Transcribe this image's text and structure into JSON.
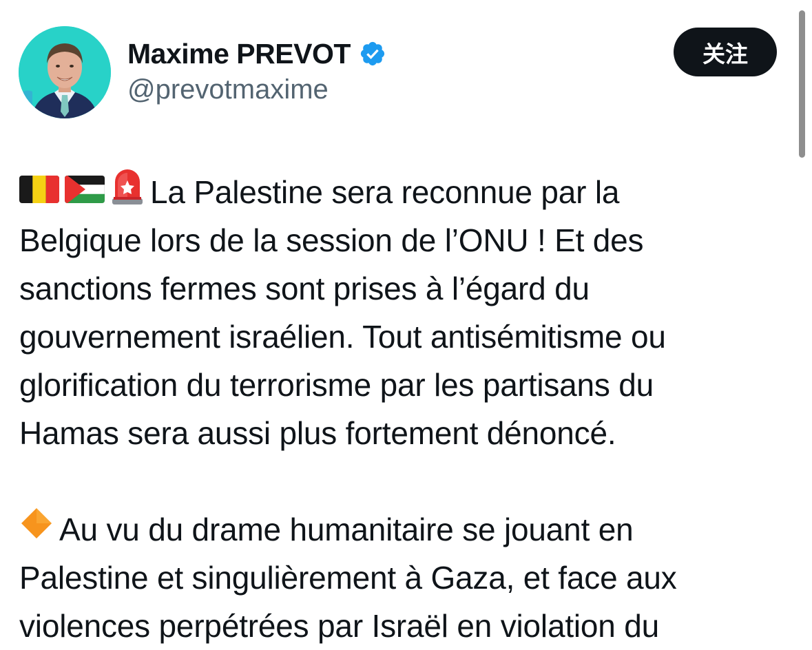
{
  "author": {
    "display_name": "Maxime PREVOT",
    "handle": "@prevotmaxime",
    "verified": true,
    "avatar_icon": "profile-photo"
  },
  "follow_button": {
    "label": "关注"
  },
  "colors": {
    "verified_blue": "#1d9bf0",
    "text_primary": "#0f1419",
    "text_secondary": "#536471",
    "avatar_bg": "#28d2c8"
  },
  "tweet": {
    "paragraph1": {
      "emojis": [
        "belgium-flag-icon",
        "palestine-flag-icon",
        "police-light-icon"
      ],
      "lines": [
        "La Palestine sera reconnue par la",
        "Belgique lors de la session de l’ONU ! Et des",
        "sanctions fermes sont prises à l’égard du",
        "gouvernement israélien. Tout antisémitisme ou",
        "glorification du terrorisme par les partisans du",
        "Hamas sera aussi plus fortement dénoncé."
      ]
    },
    "paragraph2": {
      "emojis": [
        "orange-diamond-icon"
      ],
      "lines": [
        "Au vu du drame humanitaire se jouant en",
        "Palestine et singulièrement à Gaza, et face aux",
        "violences perpétrées par Israël en violation du"
      ]
    }
  }
}
